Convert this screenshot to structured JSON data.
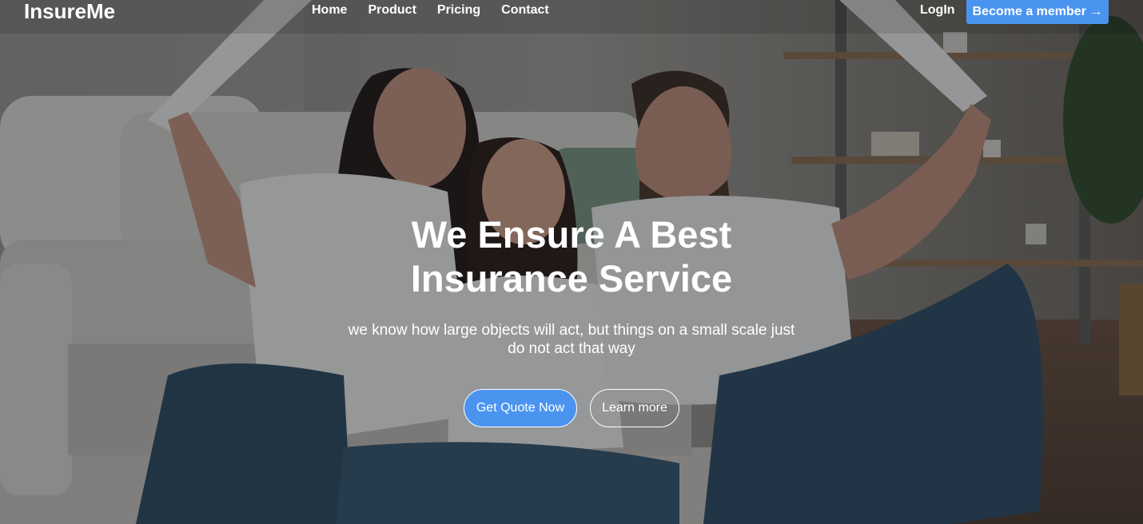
{
  "header": {
    "brand": "InsureMe",
    "nav": [
      {
        "label": "Home"
      },
      {
        "label": "Product"
      },
      {
        "label": "Pricing"
      },
      {
        "label": "Contact"
      }
    ],
    "login_label": "LogIn",
    "member_label": "Become a member →"
  },
  "hero": {
    "title": "We Ensure A Best Insurance Service",
    "subtitle": "we know how large objects will act, but things on a small scale just do not act that way",
    "primary_button": "Get Quote Now",
    "secondary_button": "Learn more",
    "background_image": "family-with-paper-roof-photo"
  },
  "colors": {
    "accent": "#4a94f0",
    "overlay": "#14161a",
    "text": "#ffffff"
  }
}
